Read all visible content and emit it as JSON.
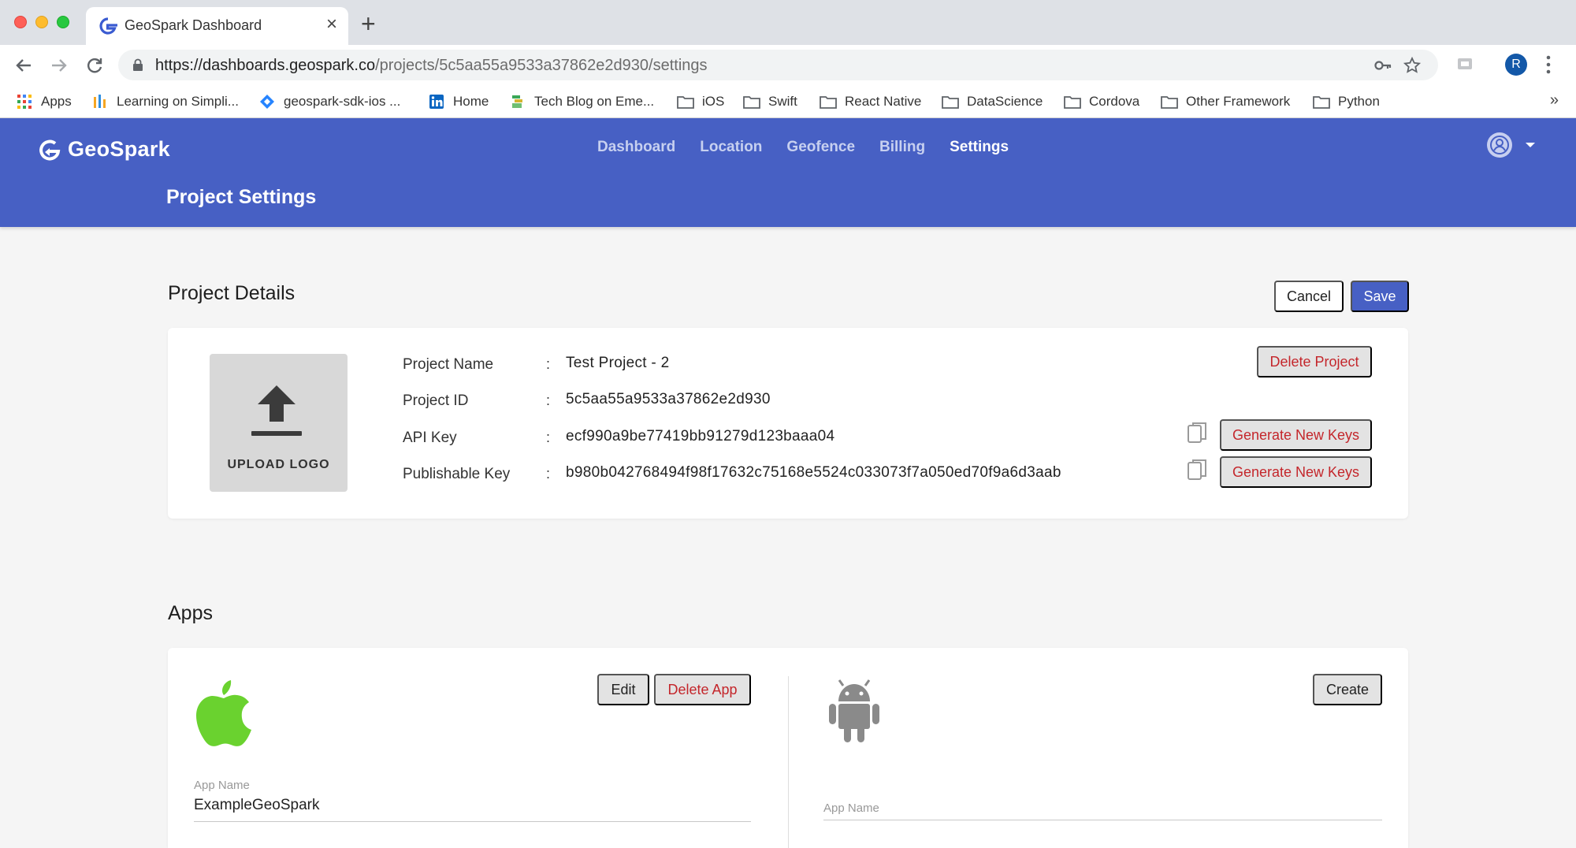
{
  "browser": {
    "tab_title": "GeoSpark Dashboard",
    "url_host": "https://dashboards.geospark.co",
    "url_path": "/projects/5c5aa55a9533a37862e2d930/settings",
    "profile_initial": "R",
    "bookmarks": [
      {
        "label": "Apps",
        "icon": "apps-grid-icon"
      },
      {
        "label": "Learning on Simpli...",
        "icon": "simplilearn-icon"
      },
      {
        "label": "geospark-sdk-ios ...",
        "icon": "jira-diamond-icon"
      },
      {
        "label": "Home",
        "icon": "linkedin-icon"
      },
      {
        "label": "Tech Blog on Eme...",
        "icon": "blog-icon"
      },
      {
        "label": "iOS",
        "icon": "folder-icon"
      },
      {
        "label": "Swift",
        "icon": "folder-icon"
      },
      {
        "label": "React Native",
        "icon": "folder-icon"
      },
      {
        "label": "DataScience",
        "icon": "folder-icon"
      },
      {
        "label": "Cordova",
        "icon": "folder-icon"
      },
      {
        "label": "Other Framework",
        "icon": "folder-icon"
      },
      {
        "label": "Python",
        "icon": "folder-icon"
      }
    ],
    "bookmarks_overflow": "»"
  },
  "header": {
    "brand": "GeoSpark",
    "nav": [
      "Dashboard",
      "Location",
      "Geofence",
      "Billing",
      "Settings"
    ],
    "active_nav": "Settings",
    "page_title": "Project Settings"
  },
  "project_details": {
    "title": "Project Details",
    "cancel_label": "Cancel",
    "save_label": "Save",
    "upload_label": "UPLOAD LOGO",
    "delete_label": "Delete Project",
    "generate_label": "Generate New Keys",
    "fields": [
      {
        "label": "Project Name",
        "value": "Test Project - 2"
      },
      {
        "label": "Project ID",
        "value": "5c5aa55a9533a37862e2d930"
      },
      {
        "label": "API Key",
        "value": "ecf990a9be77419bb91279d123baaa04"
      },
      {
        "label": "Publishable Key",
        "value": "b980b042768494f98f17632c75168e5524c033073f7a050ed70f9a6d3aab"
      }
    ],
    "colon": ":"
  },
  "apps": {
    "title": "Apps",
    "ios": {
      "edit_label": "Edit",
      "delete_label": "Delete App",
      "app_name_label": "App Name",
      "app_name_value": "ExampleGeoSpark",
      "icon_color": "#6ad22f"
    },
    "android": {
      "create_label": "Create",
      "app_name_label": "App Name",
      "icon_color": "#8a8a8a"
    }
  },
  "colors": {
    "primary": "#4760c4",
    "danger": "#c4262b"
  }
}
